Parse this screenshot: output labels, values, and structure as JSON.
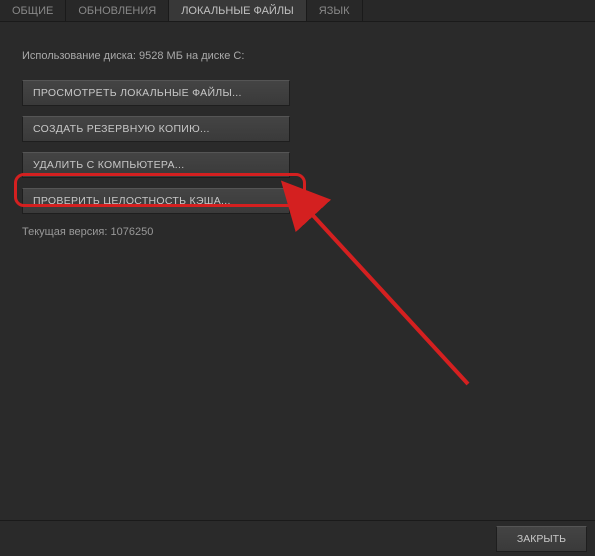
{
  "tabs": {
    "general": "ОБЩИЕ",
    "updates": "ОБНОВЛЕНИЯ",
    "local_files": "ЛОКАЛЬНЫЕ ФАЙЛЫ",
    "language": "ЯЗЫК"
  },
  "disk_usage": "Использование диска: 9528 МБ на диске C:",
  "buttons": {
    "browse": "ПРОСМОТРЕТЬ ЛОКАЛЬНЫЕ ФАЙЛЫ...",
    "backup": "СОЗДАТЬ РЕЗЕРВНУЮ КОПИЮ...",
    "delete": "УДАЛИТЬ С КОМПЬЮТЕРА...",
    "verify": "ПРОВЕРИТЬ ЦЕЛОСТНОСТЬ КЭША..."
  },
  "version": "Текущая версия: 1076250",
  "footer": {
    "close": "ЗАКРЫТЬ"
  },
  "annotation": {
    "highlight_color": "#d42020"
  }
}
